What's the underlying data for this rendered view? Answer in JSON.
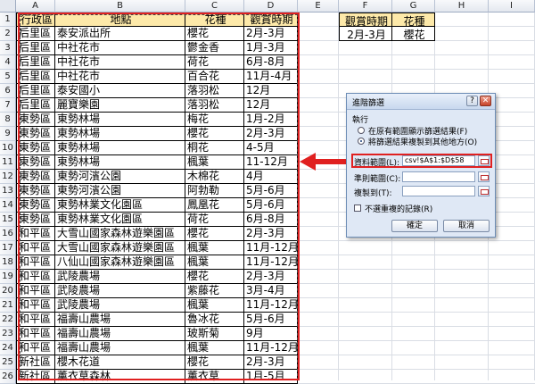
{
  "columns": [
    "A",
    "B",
    "C",
    "D",
    "E",
    "F",
    "G",
    "H",
    "I"
  ],
  "rows": [
    "1",
    "2",
    "3",
    "4",
    "5",
    "6",
    "7",
    "8",
    "9",
    "10",
    "11",
    "12",
    "13",
    "14",
    "15",
    "16",
    "17",
    "18",
    "19",
    "20",
    "21",
    "22",
    "23",
    "24",
    "25",
    "26"
  ],
  "table": {
    "headers": [
      "行政區",
      "地點",
      "花種",
      "觀賞時期"
    ],
    "data": [
      [
        "后里區",
        "泰安派出所",
        "櫻花",
        "2月-3月"
      ],
      [
        "后里區",
        "中社花市",
        "鬱金香",
        "1月-3月"
      ],
      [
        "后里區",
        "中社花市",
        "荷花",
        "6月-8月"
      ],
      [
        "后里區",
        "中社花市",
        "百合花",
        "11月-4月"
      ],
      [
        "后里區",
        "泰安國小",
        "落羽松",
        "12月"
      ],
      [
        "后里區",
        "麗寶樂園",
        "落羽松",
        "12月"
      ],
      [
        "東勢區",
        "東勢林場",
        "梅花",
        "1月-2月"
      ],
      [
        "東勢區",
        "東勢林場",
        "櫻花",
        "2月-3月"
      ],
      [
        "東勢區",
        "東勢林場",
        "桐花",
        "4-5月"
      ],
      [
        "東勢區",
        "東勢林場",
        "楓葉",
        "11-12月"
      ],
      [
        "東勢區",
        "東勢河濱公園",
        "木棉花",
        "4月"
      ],
      [
        "東勢區",
        "東勢河濱公園",
        "阿勃勒",
        "5月-6月"
      ],
      [
        "東勢區",
        "東勢林業文化園區",
        "鳳凰花",
        "5月-6月"
      ],
      [
        "東勢區",
        "東勢林業文化園區",
        "荷花",
        "6月-8月"
      ],
      [
        "和平區",
        "大雪山國家森林遊樂園區",
        "櫻花",
        "2月-3月"
      ],
      [
        "和平區",
        "大雪山國家森林遊樂園區",
        "楓葉",
        "11月-12月"
      ],
      [
        "和平區",
        "八仙山國家森林遊樂園區",
        "楓葉",
        "11月-12月"
      ],
      [
        "和平區",
        "武陵農場",
        "櫻花",
        "2月-3月"
      ],
      [
        "和平區",
        "武陵農場",
        "紫藤花",
        "3月-4月"
      ],
      [
        "和平區",
        "武陵農場",
        "楓葉",
        "11月-12月"
      ],
      [
        "和平區",
        "福壽山農場",
        "魯冰花",
        "5月-6月"
      ],
      [
        "和平區",
        "福壽山農場",
        "玻斯菊",
        "9月"
      ],
      [
        "和平區",
        "福壽山農場",
        "楓葉",
        "11月-12月"
      ],
      [
        "新社區",
        "櫻木花道",
        "櫻花",
        "2月-3月"
      ],
      [
        "新社區",
        "薰衣草森林",
        "薰衣草",
        "1月-5月"
      ]
    ]
  },
  "criteria": {
    "headers": [
      "觀賞時期",
      "花種"
    ],
    "values": [
      "2月-3月",
      "櫻花"
    ]
  },
  "dialog": {
    "title": "進階篩選",
    "help": "?",
    "close": "✕",
    "section": "執行",
    "option1": "在原有範圍顯示篩選結果(F)",
    "option2": "將篩選結果複製到其他地方(O)",
    "list_range_label": "資料範圍(L):",
    "list_range_value": "csv!$A$1:$D$58",
    "criteria_range_label": "準則範圍(C):",
    "criteria_range_value": "",
    "copy_to_label": "複製到(T):",
    "copy_to_value": "",
    "unique_label": "不選重複的記錄(R)",
    "ok": "確定",
    "cancel": "取消"
  },
  "colors": {
    "header_fill": "#fde9a9",
    "highlight_red": "#e02020",
    "dialog_bg": "#dfe8f5"
  }
}
